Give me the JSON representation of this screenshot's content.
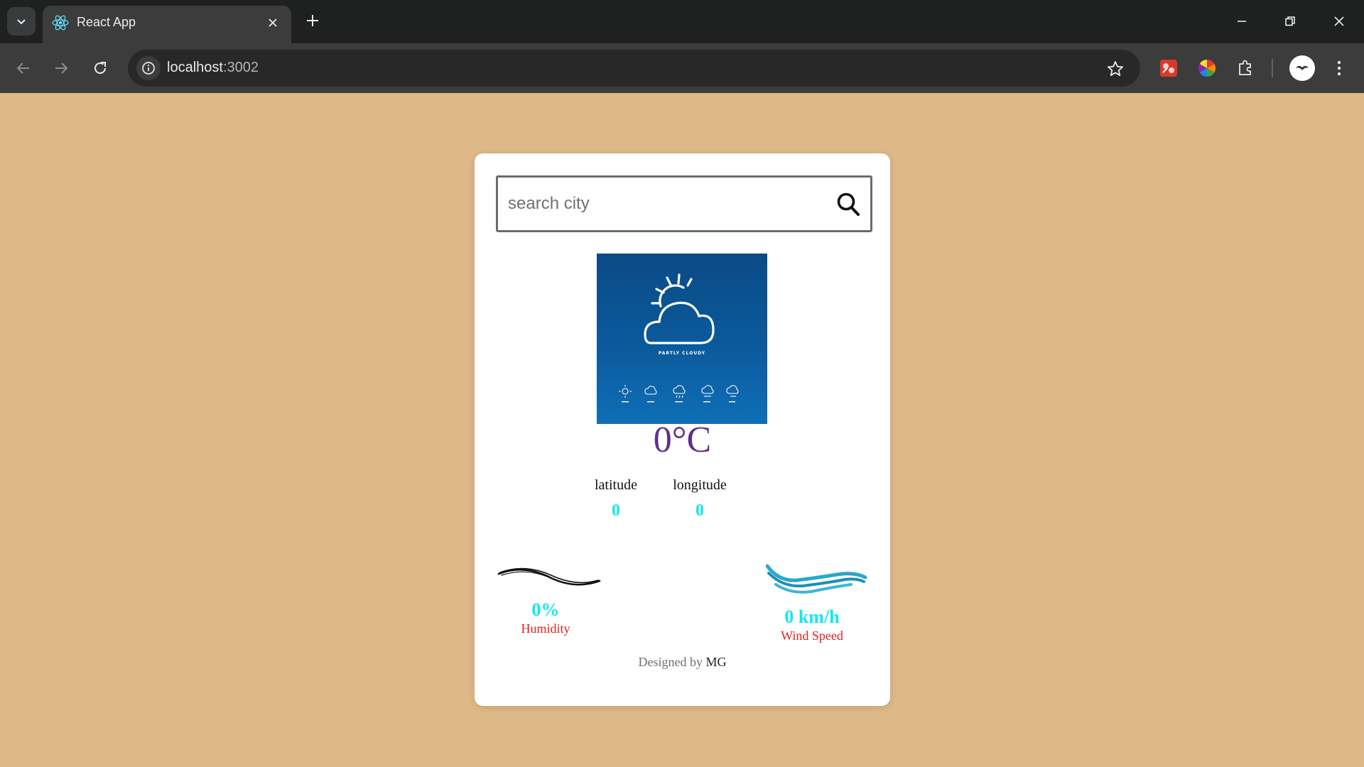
{
  "browser": {
    "tab_title": "React App",
    "url_host": "localhost",
    "url_port": ":3002",
    "icons": [
      "tab-search-icon",
      "react-logo-icon",
      "close-icon",
      "plus-icon",
      "minimize-icon",
      "restore-icon",
      "window-close-icon",
      "back-arrow-icon",
      "forward-arrow-icon",
      "reload-icon",
      "site-info-icon",
      "star-icon",
      "extension-icon",
      "color-wheel-icon",
      "puzzle-icon",
      "avatar",
      "kebab-menu-icon"
    ]
  },
  "app": {
    "background_color": "#DEB887",
    "search": {
      "placeholder": "search city",
      "value": ""
    },
    "image_caption": "PARTLY CLOUDY",
    "temperature": "0°C",
    "latitude": {
      "label": "latitude",
      "value": "0"
    },
    "longitude": {
      "label": "longitude",
      "value": "0"
    },
    "humidity": {
      "value": "0%",
      "label": "Humidity"
    },
    "wind": {
      "value": "0 km/h",
      "label": "Wind Speed"
    },
    "footer": {
      "prefix": "Designed by",
      "author": "MG"
    },
    "colors": {
      "temperature": "#5e2f8c",
      "values": "#13e8f0",
      "labels": "#e0201e"
    }
  }
}
